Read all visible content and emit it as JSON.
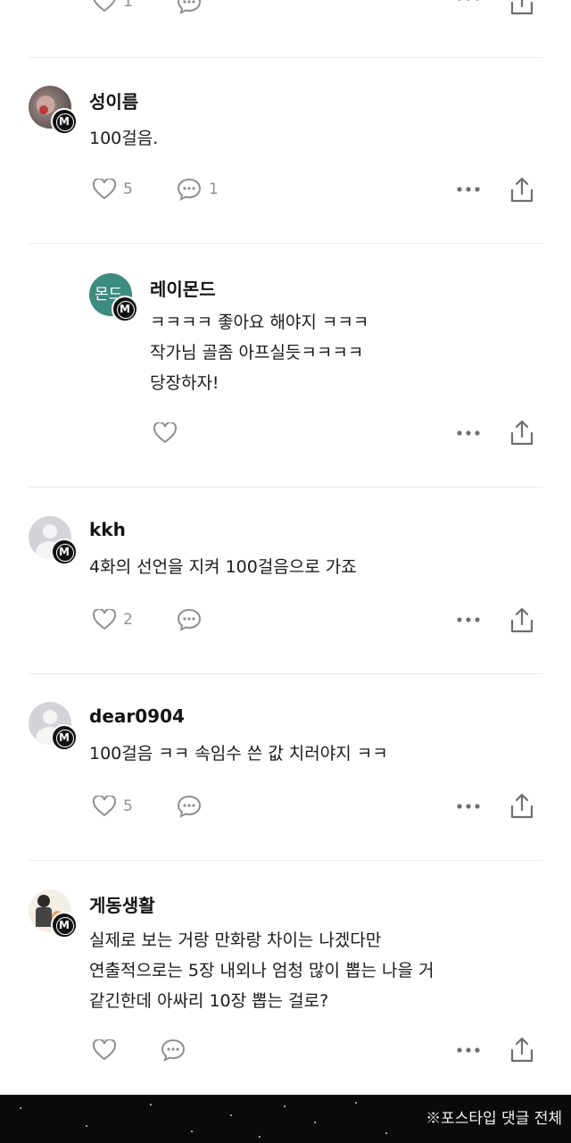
{
  "top_partial": {
    "like_count": "1"
  },
  "comments": [
    {
      "username": "성이름",
      "text": "100걸음.",
      "likes": "5",
      "replies": "1",
      "avatar": "photo"
    },
    {
      "username": "레이몬드",
      "text": "ㅋㅋㅋㅋ 좋아요 해야지 ㅋㅋㅋ\n작가님 골좀 아프실듯ㅋㅋㅋㅋ\n당장하자!",
      "avatar_text": "몬드",
      "avatar": "teal",
      "is_reply": true
    },
    {
      "username": "kkh",
      "text": "4화의 선언을 지켜 100걸음으로 가죠",
      "likes": "2",
      "avatar": "default"
    },
    {
      "username": "dear0904",
      "text": "100걸음 ㅋㅋ 속임수 쓴 값 치러야지 ㅋㅋ",
      "likes": "5",
      "avatar": "default"
    },
    {
      "username": "게동생활",
      "text": "실제로 보는 거랑 만화랑 차이는 나겠다만\n연출적으로는 5장 내외나 엄청 많이 뽑는 나을 거\n같긴한데 아싸리 10장 뽑는 걸로?",
      "avatar": "cartoon"
    }
  ],
  "badge_letter": "M",
  "footer": {
    "caption": "※포스타입 댓글 전체"
  },
  "icons": {
    "like": "heart-icon",
    "reply": "comment-bubble-icon",
    "more": "more-dots-icon",
    "share": "share-upload-icon",
    "badge": "membership-m-badge-icon"
  },
  "colors": {
    "text": "#1b1b1b",
    "icon": "#8e8e93",
    "divider": "#ececec",
    "footer_bg": "#0a0a0c",
    "avatar_teal": "#3d8c80"
  }
}
